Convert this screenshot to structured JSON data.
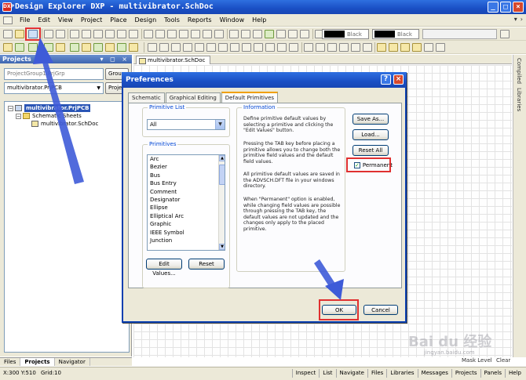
{
  "window": {
    "app_title": "Design Explorer DXP - multivibrator.SchDoc",
    "app_icon": "DXP",
    "btn_min": "_",
    "btn_max": "□",
    "btn_close": "×"
  },
  "menu": {
    "items": [
      "File",
      "Edit",
      "View",
      "Project",
      "Place",
      "Design",
      "Tools",
      "Reports",
      "Window",
      "Help"
    ],
    "right": [
      "▾",
      "›"
    ]
  },
  "toolbar": {
    "color_black_1": "Black",
    "color_black_2": "Black"
  },
  "projects_panel": {
    "title": "Projects",
    "pin_icons": "▾ ◻ ×",
    "workspace_field": "ProjectGroup1.PrjGrp",
    "workspace_button": "Group",
    "project_field": "multivibrator.PrjPCB",
    "project_button": "Proje",
    "tree": {
      "project": "multivibrator.PrjPCB",
      "folder": "Schematic Sheets",
      "document": "multivibrator.SchDoc"
    },
    "tabs": [
      "Files",
      "Projects",
      "Navigator"
    ]
  },
  "document": {
    "tab": "multivibrator.SchDoc"
  },
  "right_strip": [
    "Compiled",
    "Libraries"
  ],
  "status": {
    "coords": "X:300 Y:510",
    "grid": "Grid:10",
    "panels": [
      "Inspect",
      "List",
      "Navigate",
      "Files",
      "Libraries",
      "Messages",
      "Projects",
      "Panels",
      "Help"
    ],
    "mask_levels": "Mask Level",
    "clear": "Clear"
  },
  "watermark": {
    "brand": "Bai du 经验",
    "url": "jingyan.baidu.com"
  },
  "dialog": {
    "title": "Preferences",
    "help": "?",
    "close": "×",
    "tabs": [
      "Schematic",
      "Graphical Editing",
      "Default Primitives"
    ],
    "primitive_list_label": "Primitive List",
    "primitive_list_value": "All",
    "primitives_label": "Primitives",
    "primitives": [
      "Arc",
      "Bezier",
      "Bus",
      "Bus Entry",
      "Comment",
      "Designator",
      "Ellipse",
      "Elliptical Arc",
      "Graphic",
      "IEEE Symbol",
      "Junction"
    ],
    "edit_values_btn": "Edit Values...",
    "reset_btn": "Reset",
    "information_label": "Information",
    "info_paragraphs": [
      "Define primitive default values by selecting a primitive and clicking the \"Edit Values\" button.",
      "Pressing the TAB key before placing a primitive allows you to change both the primitive field values and the default field values.",
      "All primitive default values are saved in the ADVSCH.DFT file in your windows directory.",
      "When \"Permanent\" option is enabled, while changing field values are possible through pressing the TAB key, the default values are not updated and the changes only apply to the placed primitive."
    ],
    "save_as_btn": "Save As...",
    "load_btn": "Load...",
    "reset_all_btn": "Reset All",
    "permanent_label": "Permanent",
    "permanent_check": "✓",
    "ok_btn": "OK",
    "cancel_btn": "Cancel"
  },
  "colors": {
    "title_blue": "#1a4fc4",
    "highlight_red": "#e03030",
    "arrow_blue": "#3e5bd8"
  }
}
